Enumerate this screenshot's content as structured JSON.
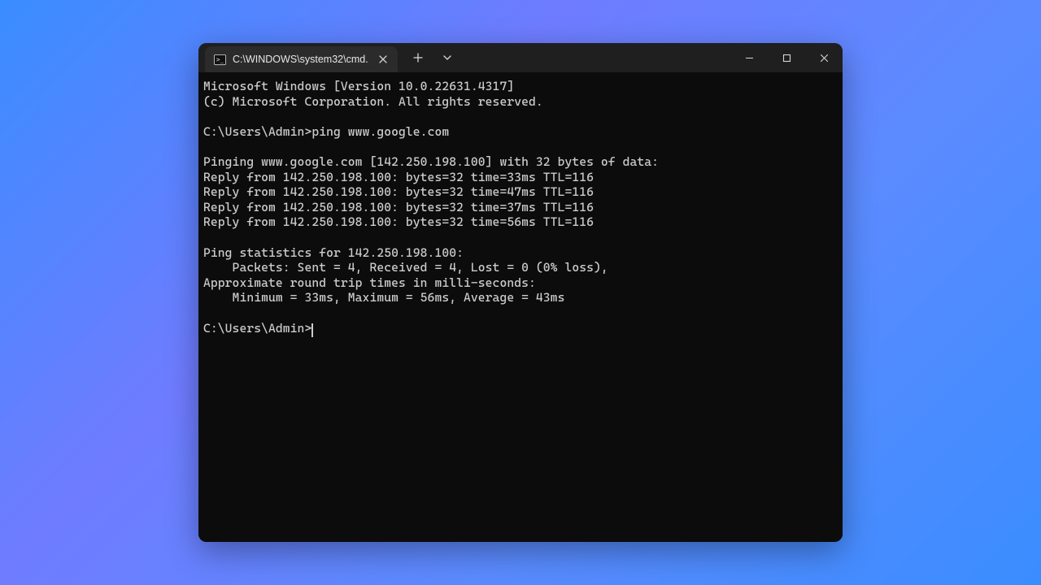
{
  "window": {
    "tab_title": "C:\\WINDOWS\\system32\\cmd."
  },
  "terminal": {
    "banner_line1": "Microsoft Windows [Version 10.0.22631.4317]",
    "banner_line2": "(c) Microsoft Corporation. All rights reserved.",
    "prompt1": "C:\\Users\\Admin>",
    "command1": "ping www.google.com",
    "ping_header": "Pinging www.google.com [142.250.198.100] with 32 bytes of data:",
    "reply1": "Reply from 142.250.198.100: bytes=32 time=33ms TTL=116",
    "reply2": "Reply from 142.250.198.100: bytes=32 time=47ms TTL=116",
    "reply3": "Reply from 142.250.198.100: bytes=32 time=37ms TTL=116",
    "reply4": "Reply from 142.250.198.100: bytes=32 time=56ms TTL=116",
    "stats_header": "Ping statistics for 142.250.198.100:",
    "packets": "    Packets: Sent = 4, Received = 4, Lost = 0 (0% loss),",
    "rtt_header": "Approximate round trip times in milli-seconds:",
    "rtt_values": "    Minimum = 33ms, Maximum = 56ms, Average = 43ms",
    "prompt2": "C:\\Users\\Admin>"
  }
}
